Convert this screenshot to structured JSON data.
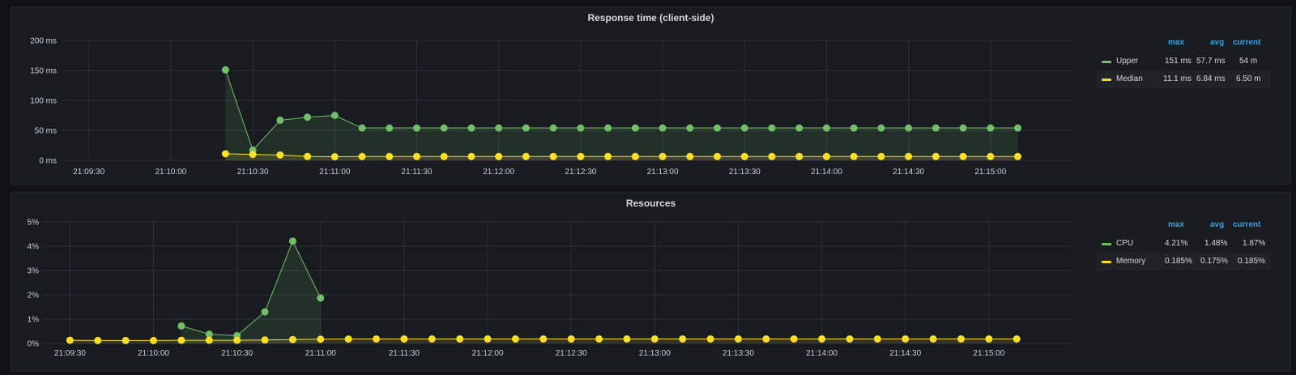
{
  "colors": {
    "green": "#73bf69",
    "yellow": "#fade2a",
    "fill_green": "rgba(115,191,105,0.13)",
    "fill_yellow": "rgba(250,222,42,0.12)"
  },
  "panels": [
    {
      "title": "Response time (client-side)",
      "legend": {
        "headers": {
          "max": "max",
          "avg": "avg",
          "current": "current"
        },
        "items": [
          {
            "name": "Upper",
            "max": "151 ms",
            "avg": "57.7 ms",
            "current": "54 m"
          },
          {
            "name": "Median",
            "max": "11.1 ms",
            "avg": "6.84 ms",
            "current": "6.50 m"
          }
        ]
      }
    },
    {
      "title": "Resources",
      "legend": {
        "headers": {
          "max": "max",
          "avg": "avg",
          "current": "current"
        },
        "items": [
          {
            "name": "CPU",
            "max": "4.21%",
            "avg": "1.48%",
            "current": "1.87%"
          },
          {
            "name": "Memory",
            "max": "0.185%",
            "avg": "0.175%",
            "current": "0.185%"
          }
        ]
      }
    }
  ],
  "chart_data": [
    {
      "type": "area",
      "title": "Response time (client-side)",
      "unit": "ms",
      "xlim": [
        "21:09:20",
        "21:15:30"
      ],
      "ylim": [
        0,
        200
      ],
      "y_ticks": [
        "0 ms",
        "50 ms",
        "100 ms",
        "150 ms",
        "200 ms"
      ],
      "y_tick_values": [
        0,
        50,
        100,
        150,
        200
      ],
      "x_ticks": [
        "21:09:30",
        "21:10:00",
        "21:10:30",
        "21:11:00",
        "21:11:30",
        "21:12:00",
        "21:12:30",
        "21:13:00",
        "21:13:30",
        "21:14:00",
        "21:14:30",
        "21:15:00"
      ],
      "grid": true,
      "legend_position": "right",
      "series": [
        {
          "name": "Upper",
          "color": "green",
          "points": [
            [
              "21:10:20",
              151
            ],
            [
              "21:10:30",
              17
            ],
            [
              "21:10:40",
              67
            ],
            [
              "21:10:50",
              72
            ],
            [
              "21:11:00",
              75
            ],
            [
              "21:11:10",
              54
            ],
            [
              "21:11:20",
              54
            ],
            [
              "21:11:30",
              54
            ],
            [
              "21:11:40",
              54
            ],
            [
              "21:11:50",
              54
            ],
            [
              "21:12:00",
              54
            ],
            [
              "21:12:10",
              54
            ],
            [
              "21:12:20",
              54
            ],
            [
              "21:12:30",
              54
            ],
            [
              "21:12:40",
              54
            ],
            [
              "21:12:50",
              54
            ],
            [
              "21:13:00",
              54
            ],
            [
              "21:13:10",
              54
            ],
            [
              "21:13:20",
              54
            ],
            [
              "21:13:30",
              54
            ],
            [
              "21:13:40",
              54
            ],
            [
              "21:13:50",
              54
            ],
            [
              "21:14:00",
              54
            ],
            [
              "21:14:10",
              54
            ],
            [
              "21:14:20",
              54
            ],
            [
              "21:14:30",
              54
            ],
            [
              "21:14:40",
              54
            ],
            [
              "21:14:50",
              54
            ],
            [
              "21:15:00",
              54
            ],
            [
              "21:15:10",
              54
            ]
          ]
        },
        {
          "name": "Median",
          "color": "yellow",
          "points": [
            [
              "21:10:20",
              11
            ],
            [
              "21:10:30",
              10
            ],
            [
              "21:10:40",
              9
            ],
            [
              "21:10:50",
              6.5
            ],
            [
              "21:11:00",
              6
            ],
            [
              "21:11:10",
              6.5
            ],
            [
              "21:11:20",
              6.5
            ],
            [
              "21:11:30",
              6.5
            ],
            [
              "21:11:40",
              6.5
            ],
            [
              "21:11:50",
              6.5
            ],
            [
              "21:12:00",
              6.5
            ],
            [
              "21:12:10",
              6.5
            ],
            [
              "21:12:20",
              6.5
            ],
            [
              "21:12:30",
              6.5
            ],
            [
              "21:12:40",
              6.5
            ],
            [
              "21:12:50",
              6.5
            ],
            [
              "21:13:00",
              6.5
            ],
            [
              "21:13:10",
              6.5
            ],
            [
              "21:13:20",
              6.5
            ],
            [
              "21:13:30",
              6.5
            ],
            [
              "21:13:40",
              6.5
            ],
            [
              "21:13:50",
              6.5
            ],
            [
              "21:14:00",
              6.5
            ],
            [
              "21:14:10",
              6.5
            ],
            [
              "21:14:20",
              6.5
            ],
            [
              "21:14:30",
              6.5
            ],
            [
              "21:14:40",
              6.5
            ],
            [
              "21:14:50",
              6.5
            ],
            [
              "21:15:00",
              6.5
            ],
            [
              "21:15:10",
              6.5
            ]
          ]
        }
      ]
    },
    {
      "type": "area",
      "title": "Resources",
      "unit": "%",
      "xlim": [
        "21:09:20",
        "21:15:30"
      ],
      "ylim": [
        0,
        5
      ],
      "y_ticks": [
        "0%",
        "1%",
        "2%",
        "3%",
        "4%",
        "5%"
      ],
      "y_tick_values": [
        0,
        1,
        2,
        3,
        4,
        5
      ],
      "x_ticks": [
        "21:09:30",
        "21:10:00",
        "21:10:30",
        "21:11:00",
        "21:11:30",
        "21:12:00",
        "21:12:30",
        "21:13:00",
        "21:13:30",
        "21:14:00",
        "21:14:30",
        "21:15:00"
      ],
      "grid": true,
      "legend_position": "right",
      "series": [
        {
          "name": "CPU",
          "color": "green",
          "points": [
            [
              "21:10:10",
              0.72
            ],
            [
              "21:10:20",
              0.38
            ],
            [
              "21:10:30",
              0.32
            ],
            [
              "21:10:40",
              1.3
            ],
            [
              "21:10:50",
              4.21
            ],
            [
              "21:11:00",
              1.87
            ]
          ]
        },
        {
          "name": "Memory",
          "color": "yellow",
          "points": [
            [
              "21:09:30",
              0.13
            ],
            [
              "21:09:40",
              0.12
            ],
            [
              "21:09:50",
              0.12
            ],
            [
              "21:10:00",
              0.12
            ],
            [
              "21:10:10",
              0.13
            ],
            [
              "21:10:20",
              0.13
            ],
            [
              "21:10:30",
              0.13
            ],
            [
              "21:10:40",
              0.14
            ],
            [
              "21:10:50",
              0.16
            ],
            [
              "21:11:00",
              0.175
            ],
            [
              "21:11:10",
              0.18
            ],
            [
              "21:11:20",
              0.185
            ],
            [
              "21:11:30",
              0.185
            ],
            [
              "21:11:40",
              0.185
            ],
            [
              "21:11:50",
              0.185
            ],
            [
              "21:12:00",
              0.185
            ],
            [
              "21:12:10",
              0.185
            ],
            [
              "21:12:20",
              0.185
            ],
            [
              "21:12:30",
              0.185
            ],
            [
              "21:12:40",
              0.185
            ],
            [
              "21:12:50",
              0.185
            ],
            [
              "21:13:00",
              0.185
            ],
            [
              "21:13:10",
              0.185
            ],
            [
              "21:13:20",
              0.185
            ],
            [
              "21:13:30",
              0.185
            ],
            [
              "21:13:40",
              0.185
            ],
            [
              "21:13:50",
              0.185
            ],
            [
              "21:14:00",
              0.185
            ],
            [
              "21:14:10",
              0.185
            ],
            [
              "21:14:20",
              0.185
            ],
            [
              "21:14:30",
              0.185
            ],
            [
              "21:14:40",
              0.185
            ],
            [
              "21:14:50",
              0.185
            ],
            [
              "21:15:00",
              0.185
            ],
            [
              "21:15:10",
              0.185
            ]
          ]
        }
      ]
    }
  ]
}
